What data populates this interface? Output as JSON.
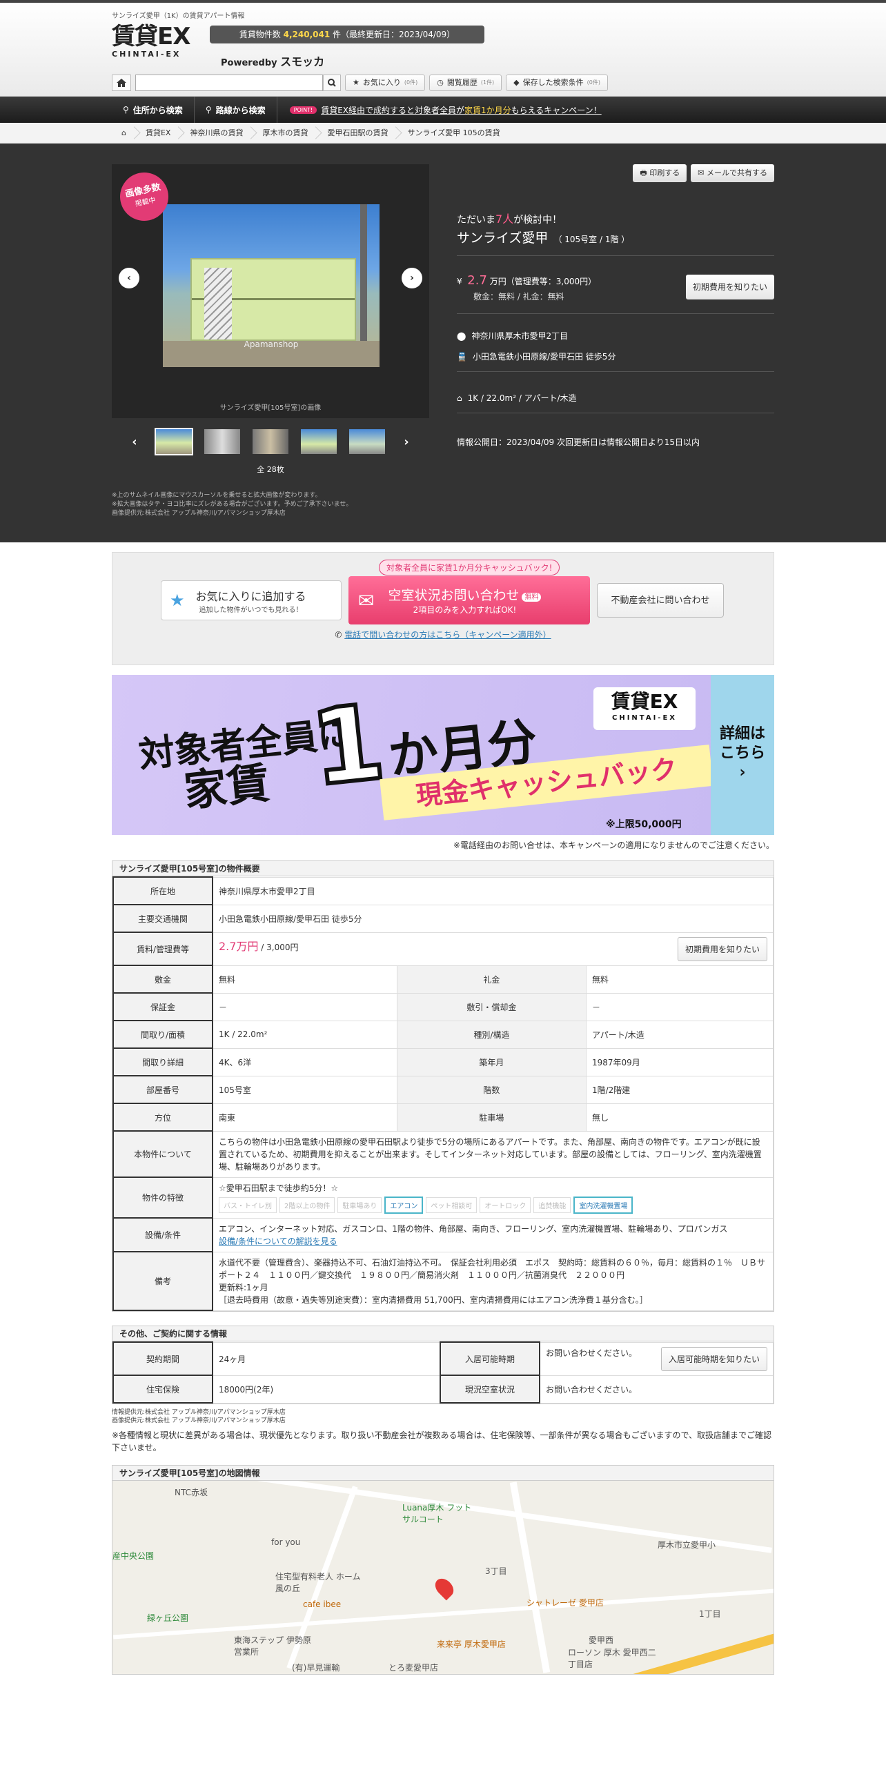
{
  "header": {
    "tagline": "サンライズ愛甲（1K）の賃貸アパート情報",
    "logo_main": "賃貸EX",
    "logo_sub": "CHINTAI-EX",
    "count_prefix": "賃貸物件数",
    "count_value": "4,240,041",
    "count_suffix": "件（最終更新日：2023/04/09）",
    "poweredby": "Poweredby",
    "poweredby_brand": "スモッカ",
    "buttons": [
      {
        "label": "お気に入り",
        "count": "(0件)"
      },
      {
        "label": "閲覧履歴",
        "count": "(1件)"
      },
      {
        "label": "保存した検索条件",
        "count": "(0件)"
      }
    ]
  },
  "nav": {
    "items": [
      "住所から検索",
      "路線から検索"
    ],
    "point": "POINT!",
    "campaign_a": "賃貸EX経由で成約すると対象者全員が",
    "campaign_b": "家賃1か月分",
    "campaign_c": "もらえるキャンペーン！"
  },
  "breadcrumb": [
    "賃貸EX",
    "神奈川県の賃貸",
    "厚木市の賃貸",
    "愛甲石田駅の賃貸",
    "サンライズ愛甲 105の賃貸"
  ],
  "gallery": {
    "badge_main": "画像多数",
    "badge_sub": "掲載中",
    "watermark": "Apamanshop",
    "caption": "サンライズ愛甲[105号室]の画像",
    "total": "全 28枚",
    "notes": [
      "※上のサムネイル画像にマウスカーソルを乗せると拡大画像が変わります。",
      "※拡大画像はタテ・ヨコ比率にズレがある場合がございます。予めご了承下さいませ。",
      "画像提供元:株式会社 アップル神奈川/アパマンショップ厚木店"
    ]
  },
  "info": {
    "print": "印刷する",
    "mail": "メールで共有する",
    "viewing_a": "ただいま",
    "viewing_n": "7人",
    "viewing_b": "が検討中！",
    "name": "サンライズ愛甲",
    "room": "（ 105号室 / 1階 ）",
    "price_value": "2.7",
    "price_unit": "万円（管理費等：3,000円）",
    "deposit": "敷金：無料 / 礼金：無料",
    "fee_btn": "初期費用を知りたい",
    "address": "神奈川県厚木市愛甲2丁目",
    "station": "小田急電鉄小田原線/愛甲石田 徒歩5分",
    "layout": "1K / 22.0m² / アパート/木造",
    "publish": "情報公開日：2023/04/09 次回更新日は情報公開日より15日以内"
  },
  "cta": {
    "tag": "対象者全員に家賃1か月分キャッシュバック!",
    "fav_main": "お気に入りに追加する",
    "fav_sub": "追加した物件がいつでも見れる！",
    "inq_main": "空室状況お問い合わせ",
    "inq_free": "無料",
    "inq_sub": "2項目のみを入力すればOK!",
    "agent": "不動産会社に問い合わせ",
    "phone": "電話で問い合わせの方はこちら（キャンペーン適用外）"
  },
  "banner": {
    "l1": "対象者全員に",
    "l2": "家賃",
    "l3": "1",
    "l4": "か月分",
    "l5": "現金キャッシュバック",
    "logo": "賃貸EX",
    "logo_sub": "CHINTAI-EX",
    "limit": "※上限50,000円",
    "side": "詳細は こちら"
  },
  "banner_note": "※電話経由のお問い合せは、本キャンペーンの適用になりませんのでご注意ください。",
  "overview": {
    "title": "サンライズ愛甲[105号室]の物件概要",
    "location_k": "所在地",
    "location_v": "神奈川県厚木市愛甲2丁目",
    "traffic_k": "主要交通機関",
    "traffic_v": "小田急電鉄小田原線/愛甲石田 徒歩5分",
    "rent_k": "賃料/管理費等",
    "rent_v": "2.7万円",
    "rent_sub": "/ 3,000円",
    "rent_btn": "初期費用を知りたい",
    "rows": [
      [
        "敷金",
        "無料",
        "礼金",
        "無料"
      ],
      [
        "保証金",
        "－",
        "敷引・償却金",
        "－"
      ],
      [
        "間取り/面積",
        "1K / 22.0m²",
        "種別/構造",
        "アパート/木造"
      ],
      [
        "間取り詳細",
        "4K、6洋",
        "築年月",
        "1987年09月"
      ],
      [
        "部屋番号",
        "105号室",
        "階数",
        "1階/2階建"
      ],
      [
        "方位",
        "南東",
        "駐車場",
        "無し"
      ]
    ],
    "about_k": "本物件について",
    "about_v": "こちらの物件は小田急電鉄小田原線の愛甲石田駅より徒歩で5分の場所にあるアパートです。また、角部屋、南向きの物件です。エアコンが既に設置されているため、初期費用を抑えることが出来ます。そしてインターネット対応しています。部屋の設備としては、フローリング、室内洗濯機置場、駐輪場ありがあります。",
    "feat_k": "物件の特徴",
    "feat_head": "☆愛甲石田駅まで徒歩約5分！☆",
    "features": [
      "バス・トイレ別",
      "2階以上の物件",
      "駐車場あり",
      "エアコン",
      "ペット相談可",
      "オートロック",
      "追焚機能",
      "室内洗濯機置場"
    ],
    "equip_k": "設備/条件",
    "equip_v": "エアコン、インターネット対応、ガスコンロ、1階の物件、角部屋、南向き、フローリング、室内洗濯機置場、駐輪場あり、プロパンガス",
    "equip_link": "設備/条件についての解説を見る",
    "remarks_k": "備考",
    "remarks_v": [
      "水道代不要（管理費含）、楽器持込不可、石油灯油持込不可。　保証会社利用必須　エポス　契約時：総賃料の６０％，毎月：総賃料の１％　ＵＢサポート２４　１１００円／鍵交換代　１９８００円／簡易消火剤　１１０００円／抗菌消臭代　２２０００円",
      "更新料:1ヶ月",
      "［退去時費用（故意・過失等別途実費）：室内清掃費用 51,700円、室内清掃費用にはエアコン洗浄費１基分含む。］"
    ]
  },
  "contract": {
    "title": "その他、ご契約に関する情報",
    "term_k": "契約期間",
    "term_v": "24ヶ月",
    "move_k": "入居可能時期",
    "move_v": "お問い合わせください。",
    "move_btn": "入居可能時期を知りたい",
    "ins_k": "住宅保険",
    "ins_v": "18000円(2年)",
    "vac_k": "現況空室状況",
    "vac_v": "お問い合わせください。"
  },
  "sources": [
    "情報提供元:株式会社 アップル神奈川/アパマンショップ厚木店",
    "画像提供元:株式会社 アップル神奈川/アパマンショップ厚木店"
  ],
  "disclaimer": "※各種情報と現状に差異がある場合は、現状優先となります。取り扱い不動産会社が複数ある場合は、住宅保険等、一部条件が異なる場合もございますので、取扱店舗までご確認下さいませ。",
  "map": {
    "title": "サンライズ愛甲[105号室]の地図情報",
    "labels": [
      "NTC赤坂",
      "Luana厚木 フットサルコート",
      "for you",
      "産中央公園",
      "住宅型有料老人 ホーム 風の丘",
      "cafe ibee",
      "緑ヶ丘公園",
      "東海ステップ 伊勢原営業所",
      "3丁目",
      "シャトレーゼ 愛甲店",
      "厚木市立愛甲小",
      "1丁目",
      "愛甲西",
      "来来亭 厚木愛甲店",
      "ローソン 厚木 愛甲西二丁目店",
      "とろ麦愛甲店",
      "(有)早見運輸"
    ]
  }
}
